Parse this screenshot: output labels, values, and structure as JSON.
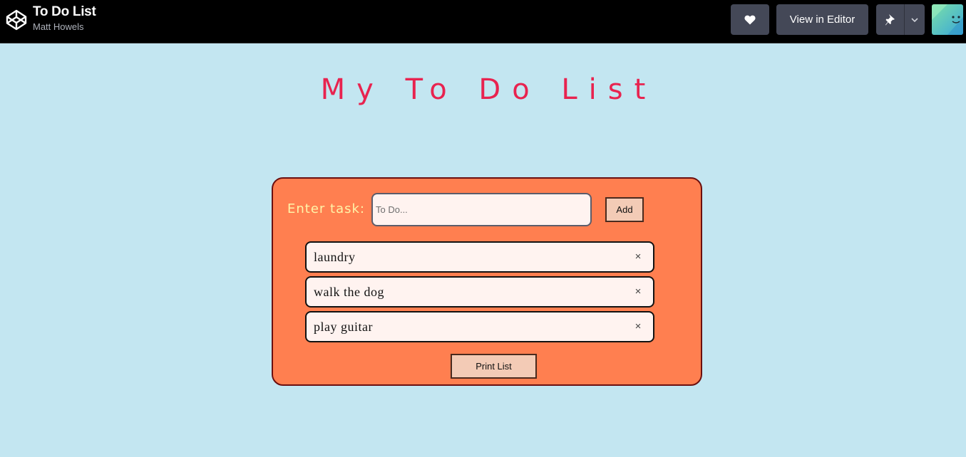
{
  "topbar": {
    "title": "To Do List",
    "author": "Matt Howels",
    "view_in_editor_label": "View in Editor",
    "icons": [
      "codepen-logo-icon",
      "heart-icon",
      "pin-icon",
      "chevron-down-icon"
    ],
    "bg_color": "#000000",
    "button_color": "#444857"
  },
  "app": {
    "heading": "My To Do List",
    "enter_task_label": "Enter task:",
    "input_value": "",
    "input_placeholder": "To Do...",
    "add_label": "Add",
    "tasks": [
      {
        "text": "laundry",
        "remove": "×"
      },
      {
        "text": "walk the dog",
        "remove": "×"
      },
      {
        "text": "play guitar",
        "remove": "×"
      }
    ],
    "print_label": "Print List",
    "colors": {
      "page_bg": "#c3e6f1",
      "card_bg": "#ff7f50",
      "heading": "#e8234f",
      "label": "#fff4a8"
    }
  }
}
